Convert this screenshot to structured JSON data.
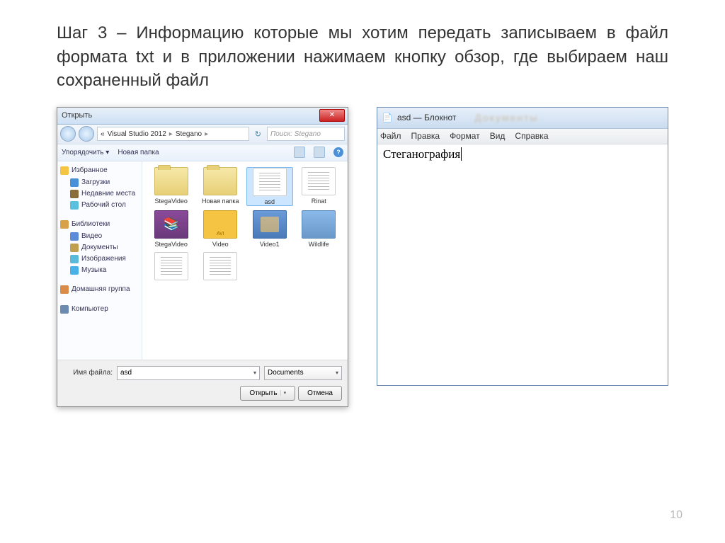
{
  "slide": {
    "text": "Шаг 3 – Информацию которые мы хотим передать записываем в файл формата txt и в приложении нажимаем кнопку обзор, где выбираем наш сохраненный файл",
    "page": "10"
  },
  "filedialog": {
    "title": "Открыть",
    "breadcrumb": {
      "seg1": "Visual Studio 2012",
      "seg2": "Stegano"
    },
    "search_placeholder": "Поиск: Stegano",
    "toolbar": {
      "organize": "Упорядочить ▾",
      "newfolder": "Новая папка"
    },
    "sidebar": {
      "fav": "Избранное",
      "downloads": "Загрузки",
      "recent": "Недавние места",
      "desktop": "Рабочий стол",
      "libs": "Библиотеки",
      "video": "Видео",
      "docs": "Документы",
      "images": "Изображения",
      "music": "Музыка",
      "homegroup": "Домашняя группа",
      "computer": "Компьютер"
    },
    "files": {
      "f0": "StegaVideo",
      "f1": "Новая папка",
      "f2": "asd",
      "f3": "Rinat",
      "f4": "StegaVideo",
      "f5": "Video",
      "f6": "Video1",
      "f7": "Wildlife"
    },
    "filename_label": "Имя файла:",
    "filename_value": "asd",
    "filter": "Documents",
    "open_btn": "Открыть",
    "cancel_btn": "Отмена"
  },
  "notepad": {
    "title": "asd — Блокнот",
    "menu": {
      "file": "Файл",
      "edit": "Правка",
      "format": "Формат",
      "view": "Вид",
      "help": "Справка"
    },
    "content": "Стеганография"
  }
}
